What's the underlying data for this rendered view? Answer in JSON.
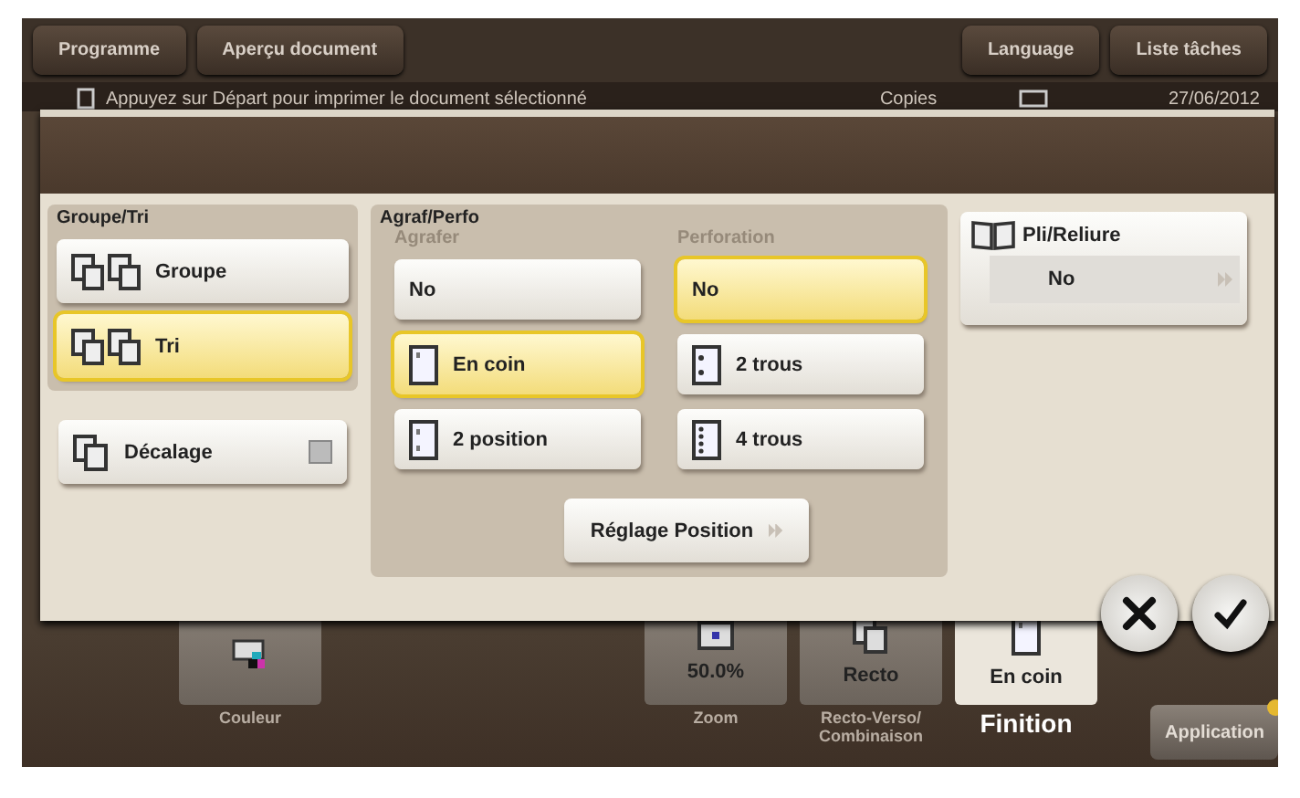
{
  "top_bar": {
    "left_buttons": [
      {
        "label": "Programme"
      },
      {
        "label": "Aperçu document"
      }
    ],
    "right_buttons": [
      {
        "label": "Language"
      },
      {
        "label": "Liste tâches"
      }
    ]
  },
  "job_row": {
    "message": "Appuyez sur Départ pour imprimer le document sélectionné",
    "column_2": "Copies",
    "date": "27/06/2012"
  },
  "dialog": {
    "sort_group": {
      "title": "Groupe/Tri",
      "options": [
        {
          "label": "Groupe",
          "selected": false
        },
        {
          "label": "Tri",
          "selected": true
        }
      ]
    },
    "offset": {
      "label": "Décalage",
      "checked": false
    },
    "staple_punch": {
      "title": "Agraf/Perfo",
      "staple": {
        "title": "Agrafer",
        "options": [
          {
            "label": "No",
            "kind": "none",
            "selected": false
          },
          {
            "label": "En coin",
            "kind": "corner",
            "selected": true
          },
          {
            "label": "2 position",
            "kind": "two",
            "selected": false
          }
        ]
      },
      "punch": {
        "title": "Perforation",
        "options": [
          {
            "label": "No",
            "kind": "none",
            "selected": true
          },
          {
            "label": "2 trous",
            "kind": "two-holes",
            "selected": false
          },
          {
            "label": "4 trous",
            "kind": "four-holes",
            "selected": false
          }
        ]
      },
      "position_button": "Réglage Position"
    },
    "fold": {
      "title": "Pli/Reliure",
      "value": "No"
    }
  },
  "tiles": [
    {
      "kind": "color",
      "caption": [
        "Couleur"
      ],
      "selected": false
    },
    {
      "kind": "zoom",
      "value": "50.0%",
      "caption": [
        "Zoom"
      ],
      "selected": false
    },
    {
      "kind": "duplex",
      "value": "Recto",
      "caption": [
        "Recto-Verso/",
        "Combinaison"
      ],
      "selected": false
    },
    {
      "kind": "finish",
      "value": "En coin",
      "caption": [
        "Finition"
      ],
      "selected": true
    }
  ],
  "application_button": "Application"
}
